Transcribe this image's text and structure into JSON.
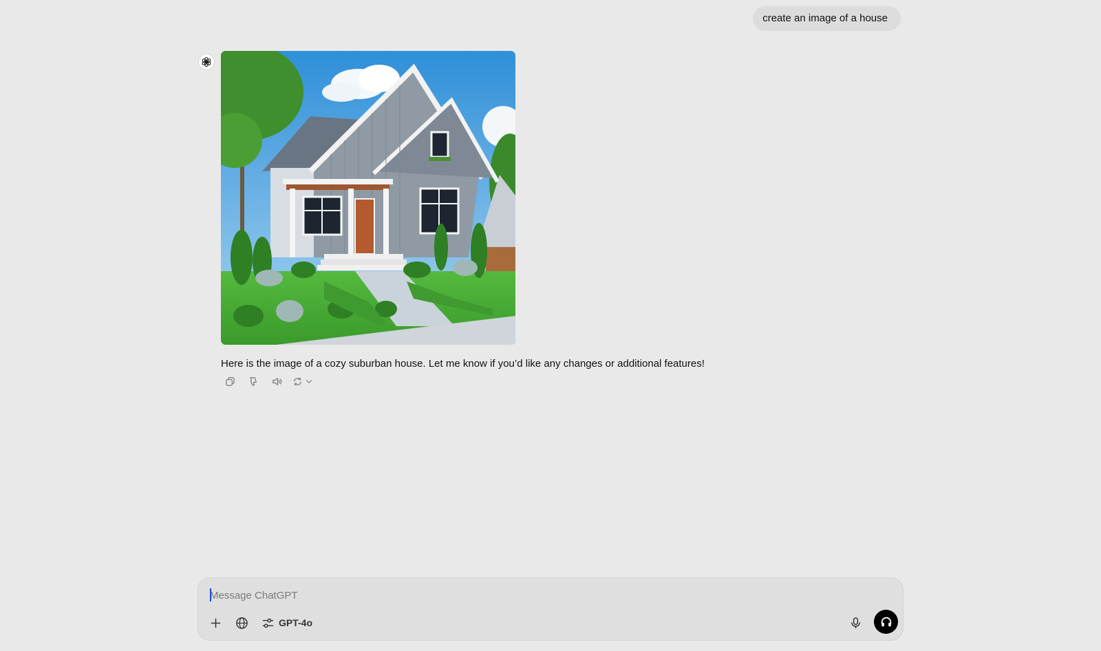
{
  "conversation": {
    "user_message": "create an image of a house",
    "assistant": {
      "avatar_icon": "openai-logo-icon",
      "image_subject": "cozy suburban house",
      "reply": "Here is the image of a cozy suburban house. Let me know if you’d like any changes or additional features!",
      "actions": [
        {
          "icon": "copy-icon"
        },
        {
          "icon": "thumbs-down-icon"
        },
        {
          "icon": "read-aloud-icon"
        },
        {
          "icon": "regenerate-icon"
        }
      ]
    }
  },
  "composer": {
    "placeholder": "Message ChatGPT",
    "value": "",
    "tools": {
      "attach_icon": "plus-icon",
      "search_icon": "globe-icon",
      "model_icon": "sliders-icon",
      "model_label": "GPT-4o",
      "mic_icon": "microphone-icon",
      "voice_icon": "headphones-icon"
    }
  },
  "colors": {
    "background": "#e9e9e9",
    "bubble": "#dcdcdc",
    "composer": "#dfdfdf",
    "voice_button": "#000000",
    "caret": "#1f49d8"
  }
}
